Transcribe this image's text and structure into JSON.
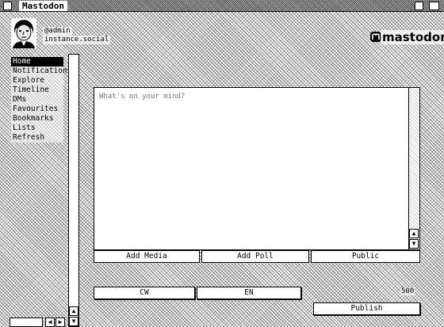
{
  "window": {
    "title": "Mastodon"
  },
  "account": {
    "handle": "@admin",
    "instance": "instance.social"
  },
  "brand": {
    "logo_text": "mastodon"
  },
  "nav": {
    "items": [
      {
        "label": "Home",
        "active": true
      },
      {
        "label": "Notifications"
      },
      {
        "label": "Explore"
      },
      {
        "label": "Timeline"
      },
      {
        "label": "DMs"
      },
      {
        "label": "Favourites"
      },
      {
        "label": "Bookmarks"
      },
      {
        "label": "Lists"
      },
      {
        "label": "Refresh"
      }
    ]
  },
  "compose": {
    "placeholder": "What's on your mind?",
    "value": "",
    "add_media_label": "Add Media",
    "add_poll_label": "Add Poll",
    "visibility_label": "Public",
    "cw_label": "CW",
    "language_label": "EN",
    "char_count": "500",
    "publish_label": "Publish"
  }
}
